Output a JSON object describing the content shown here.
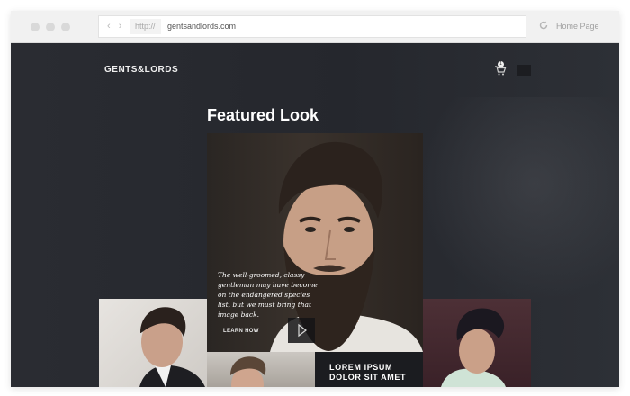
{
  "browser": {
    "protocol": "http://",
    "url": "gentsandlords.com",
    "home_label": "Home Page",
    "nav_arrows": "‹ ›"
  },
  "site": {
    "logo": "GENTS&LORDS",
    "cart_count": "1",
    "hero_title": "Featured Look",
    "hero_quote": "The well-groomed, classy gentleman may have become on the endangered species list, but we must bring that image back.",
    "learn_label": "LEARN HOW",
    "lorem_tile": "LOREM IPSUM DOLOR SIT AMET"
  },
  "colors": {
    "page_bg": "#2a2c32",
    "accent": "#ffffff"
  },
  "icons": [
    "cart-icon",
    "menu-icon",
    "reload-icon",
    "play-icon"
  ]
}
